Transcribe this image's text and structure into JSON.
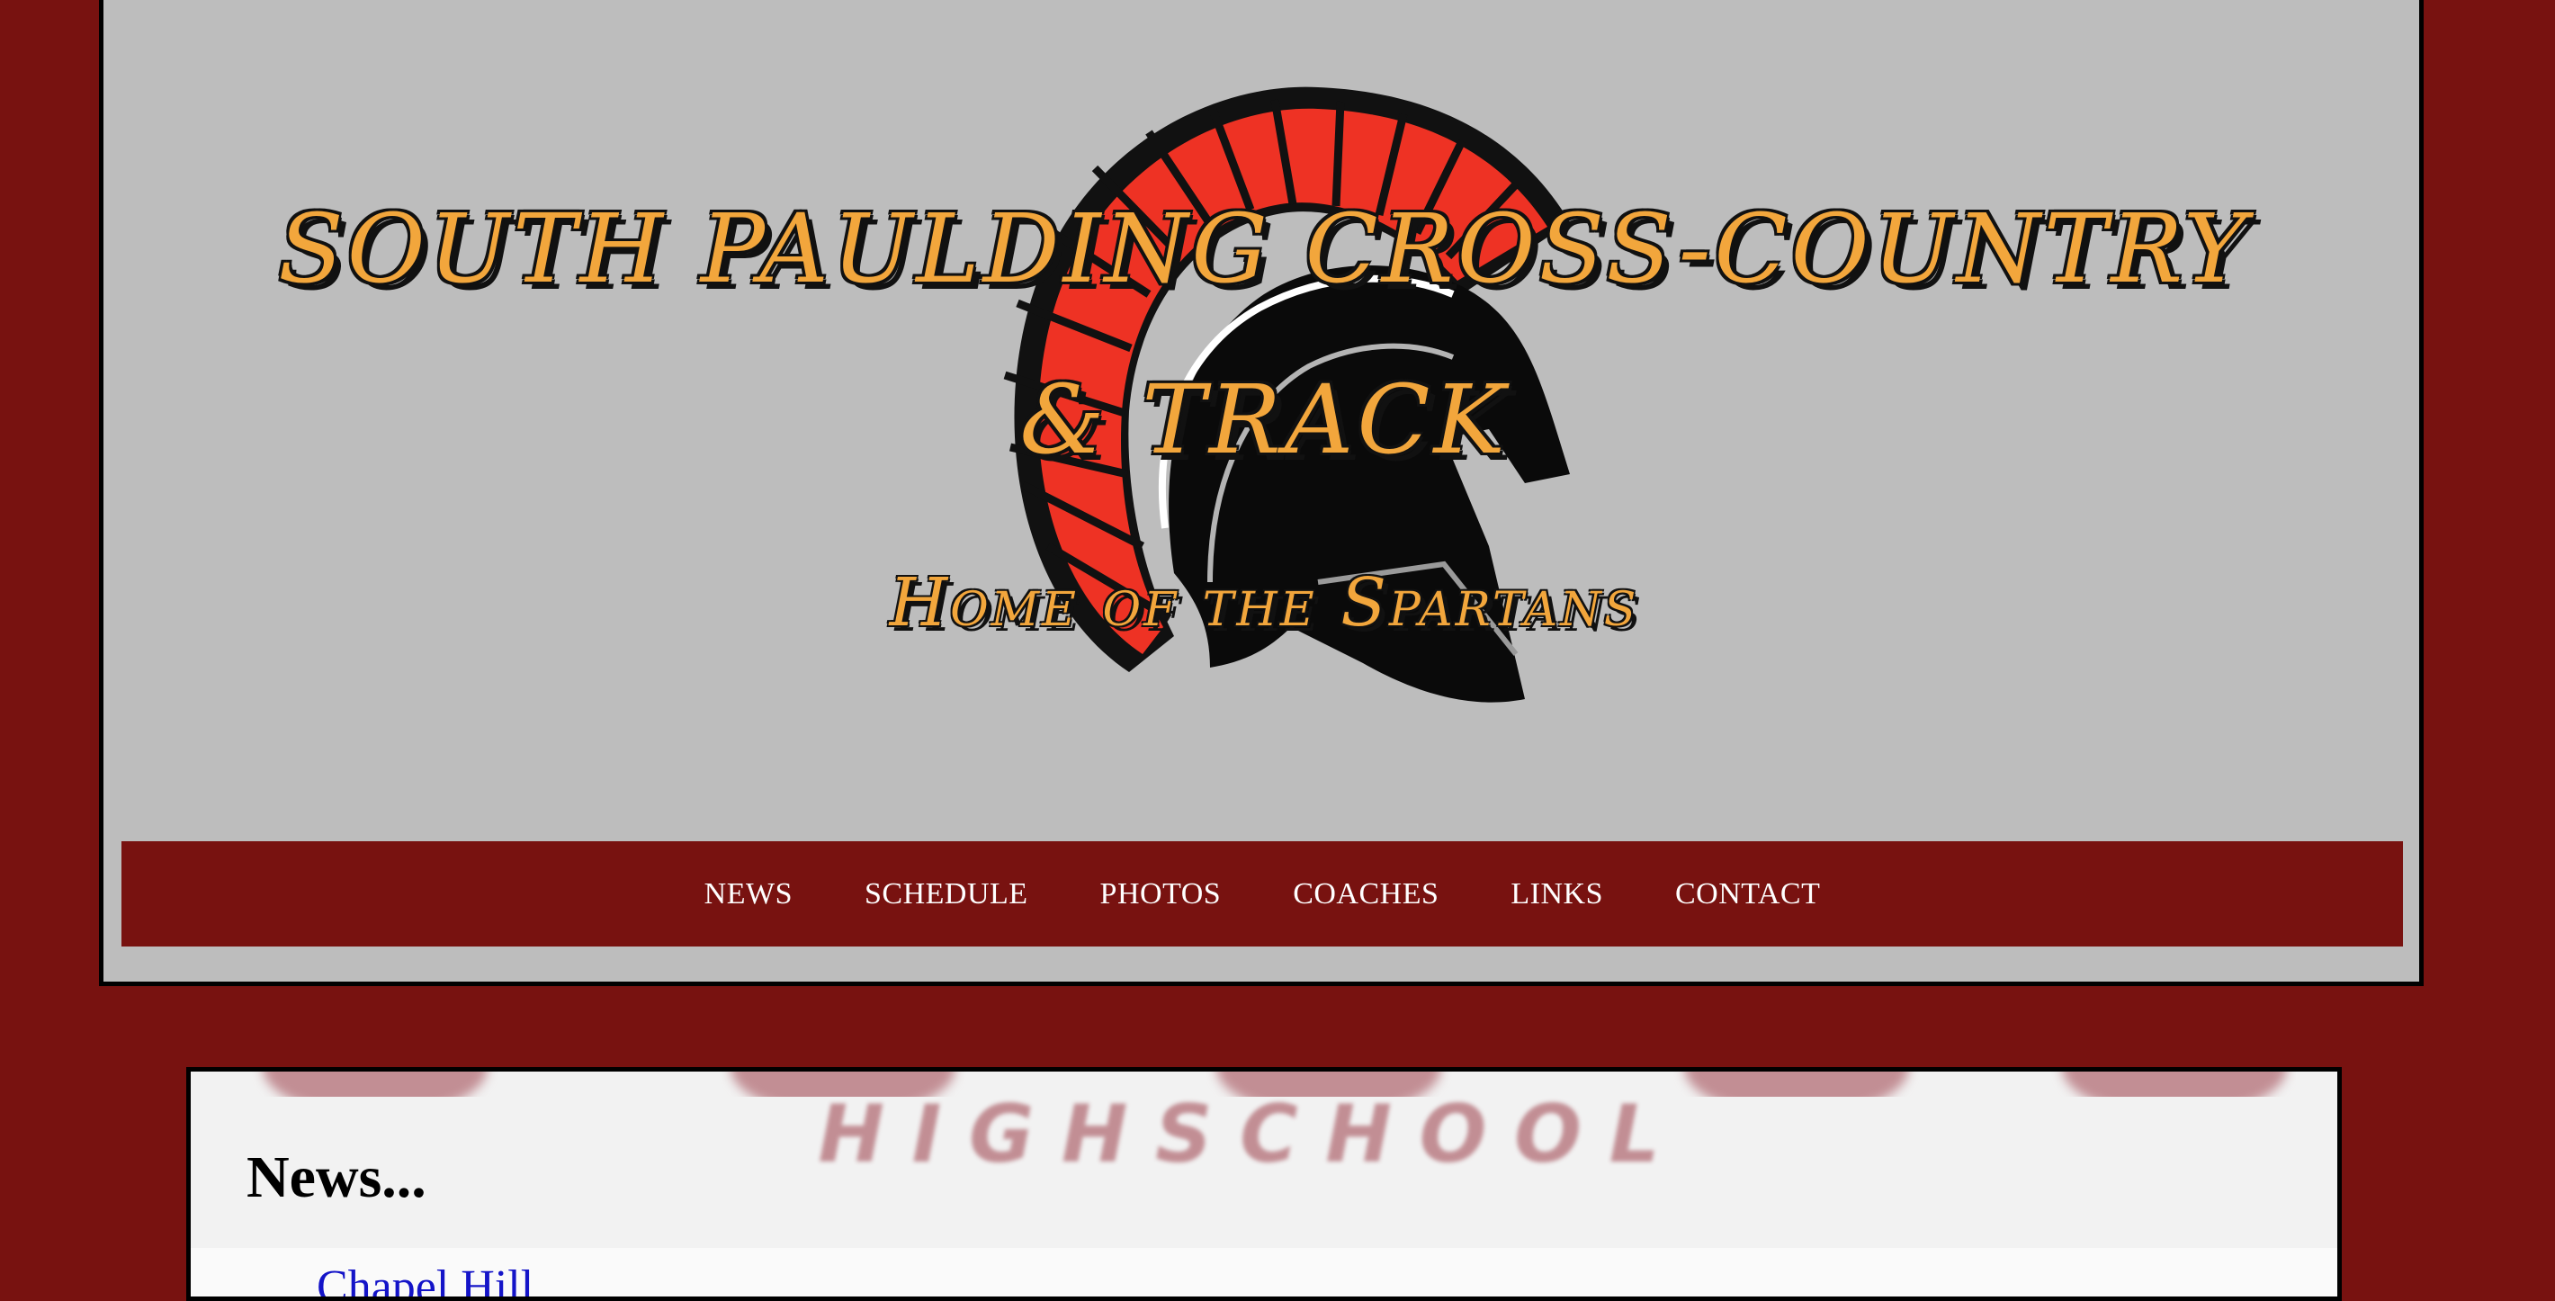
{
  "header": {
    "title": "SOUTH PAULDING CROSS-COUNTRY & TRACK",
    "tagline": "Home of the Spartans",
    "logo_icon": "spartan-helmet-icon"
  },
  "nav": {
    "items": [
      {
        "label": "NEWS"
      },
      {
        "label": "SCHEDULE"
      },
      {
        "label": "PHOTOS"
      },
      {
        "label": "COACHES"
      },
      {
        "label": "LINKS"
      },
      {
        "label": "CONTACT"
      }
    ]
  },
  "main": {
    "watermark": "H I G H   S C H O O L",
    "heading": "News...",
    "news_items": [
      {
        "label": "Chapel Hill"
      }
    ]
  },
  "colors": {
    "background": "#781210",
    "header_panel": "#bdbdbd",
    "nav_bar": "#781210",
    "title_text": "#f2a63c",
    "helmet_crest": "#ee3224",
    "link": "#1414c8"
  }
}
